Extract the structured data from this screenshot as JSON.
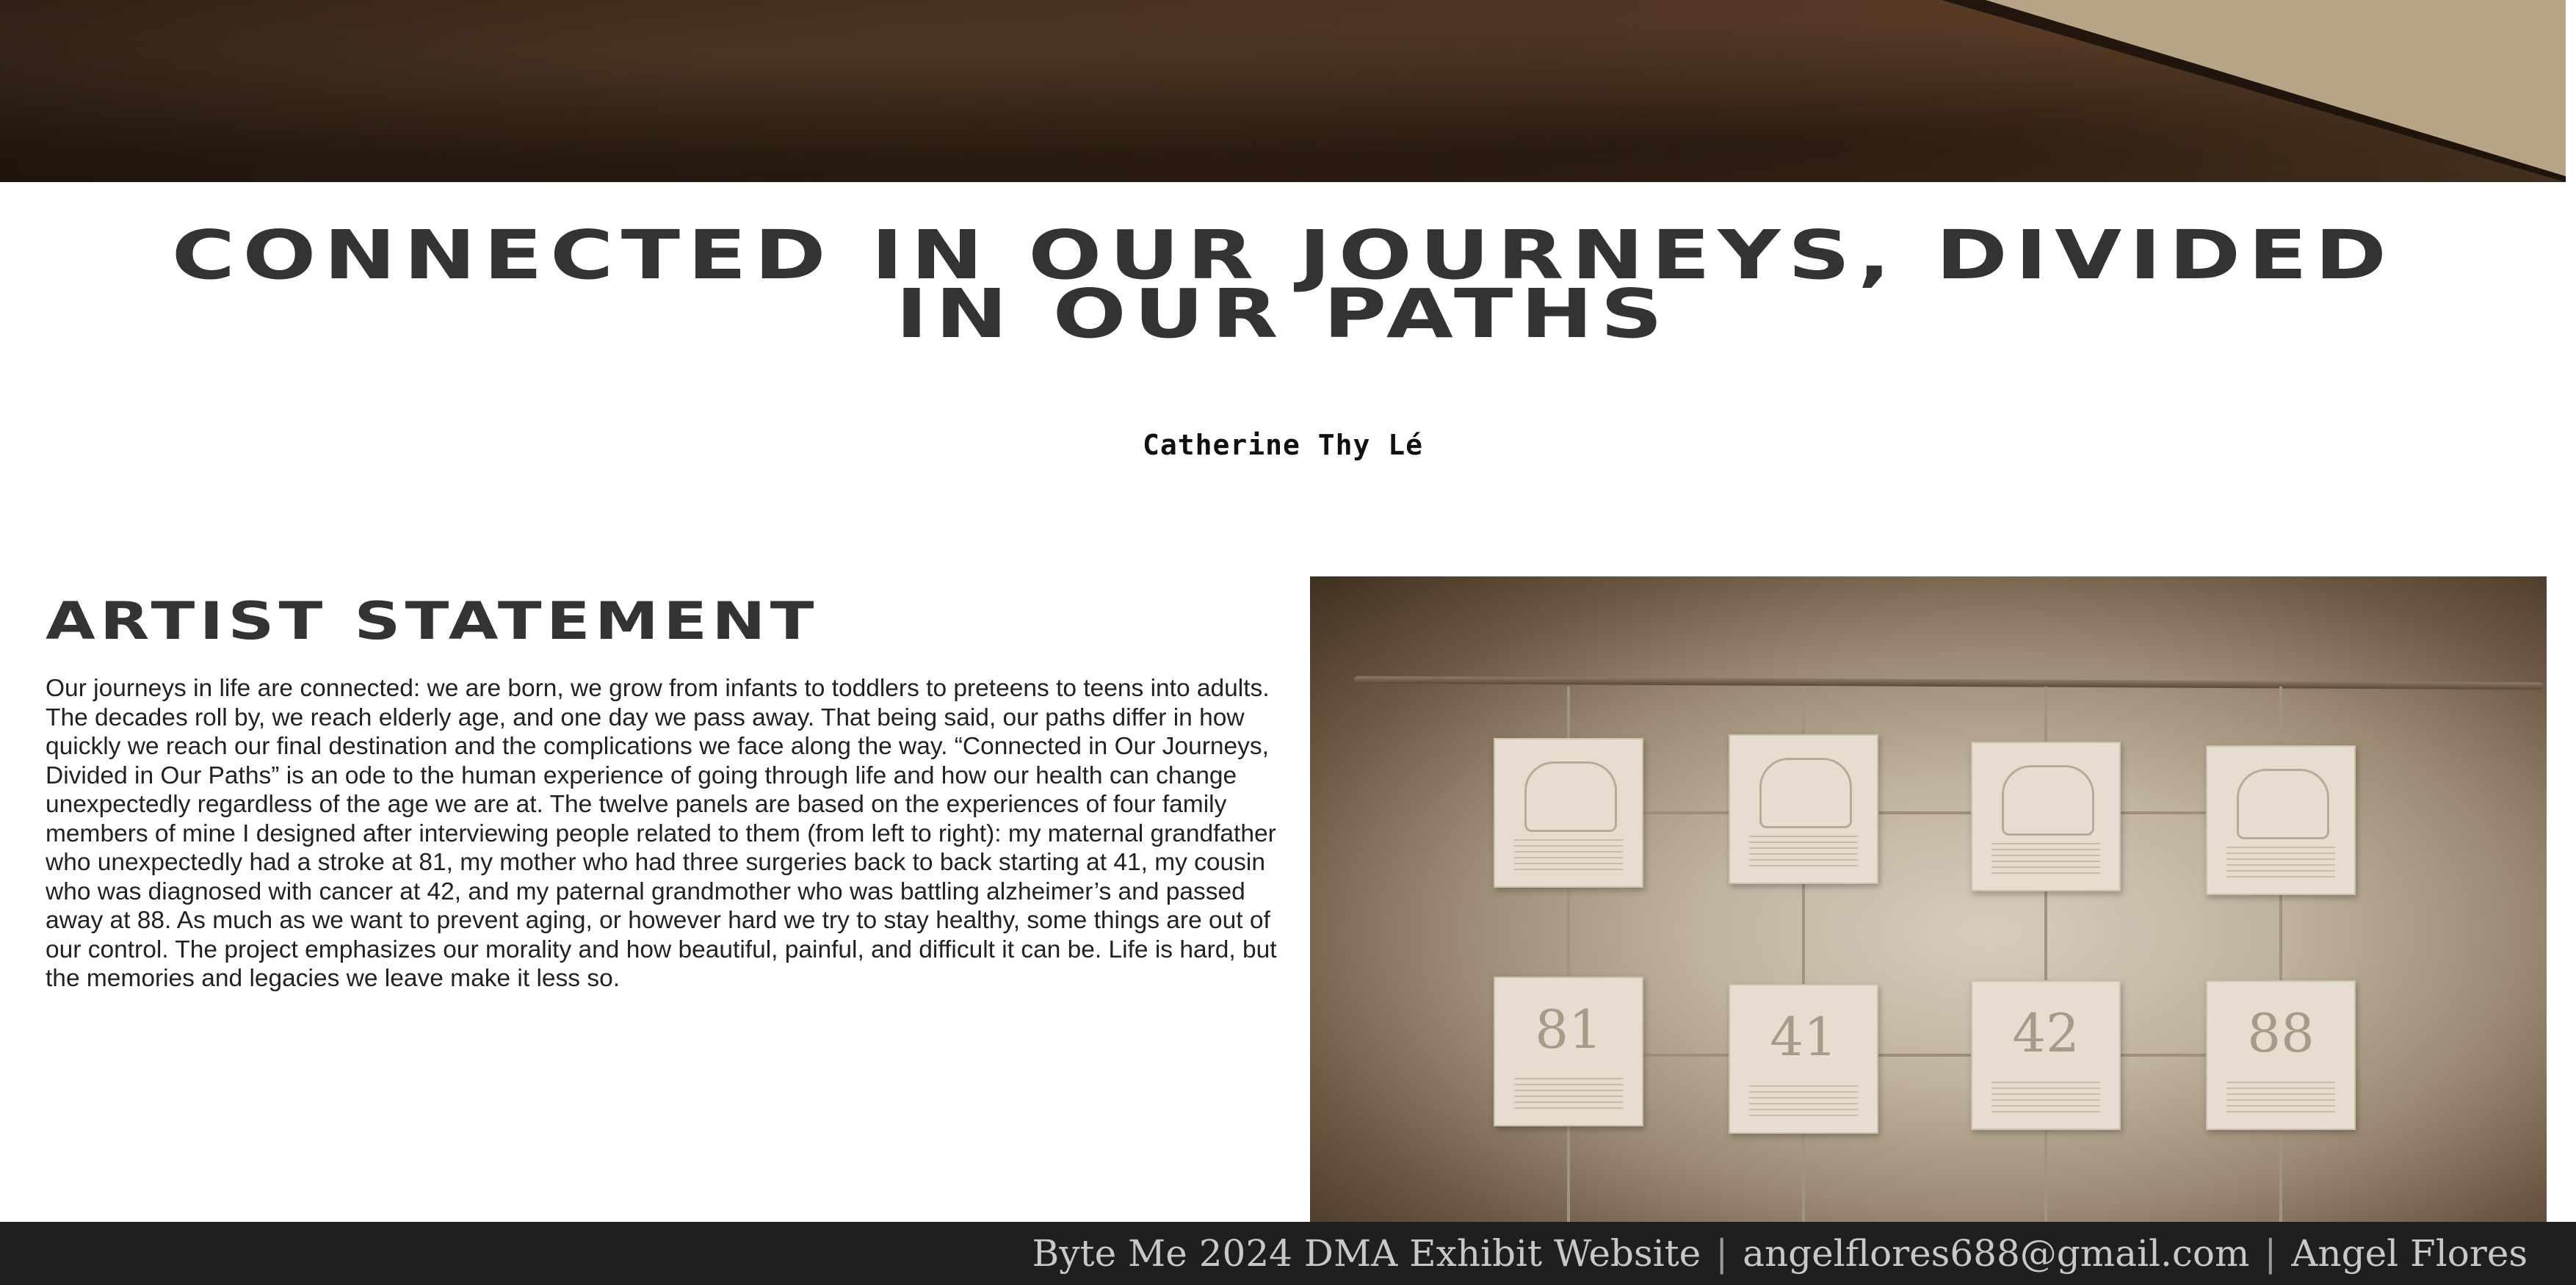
{
  "page": {
    "title": "Connected in Our Journeys, Divided in Our Paths",
    "artist": "Catherine Thy Lé"
  },
  "statement": {
    "heading": "Artist Statement",
    "body": "Our journeys in life are connected: we are born, we grow from infants to toddlers to preteens to teens into adults. The decades roll by, we reach elderly age, and one day we pass away. That being said, our paths differ in how quickly we reach our final destination and the complications we face along the way. “Connected in Our Journeys, Divided in Our Paths” is an ode to the human experience of going through life and how our health can change unexpectedly regardless of the age we are at. The twelve panels are based on the experiences of four family members of mine I designed after interviewing people related to them (from left to right): my maternal grandfather who unexpectedly had a stroke at 81, my mother who had three surgeries back to back starting at 41, my cousin who was diagnosed with cancer at 42, and my paternal grandmother who was battling alzheimer’s and passed away at 88. As much as we want to prevent aging, or however hard we try to stay healthy, some things are out of our control. The project emphasizes our morality and how beautiful, painful, and difficult it can be. Life is hard, but the memories and legacies we leave make it less so."
  },
  "artwork": {
    "panel_numbers": [
      "81",
      "41",
      "42",
      "88"
    ]
  },
  "footer": {
    "site": "Byte Me 2024 DMA Exhibit Website",
    "email": "angelflores688@gmail.com",
    "author": "Angel Flores",
    "separator": "|"
  },
  "colors": {
    "heading": "#333333",
    "footer_bg": "#1f1f1f",
    "footer_text": "#c8c8c8"
  }
}
